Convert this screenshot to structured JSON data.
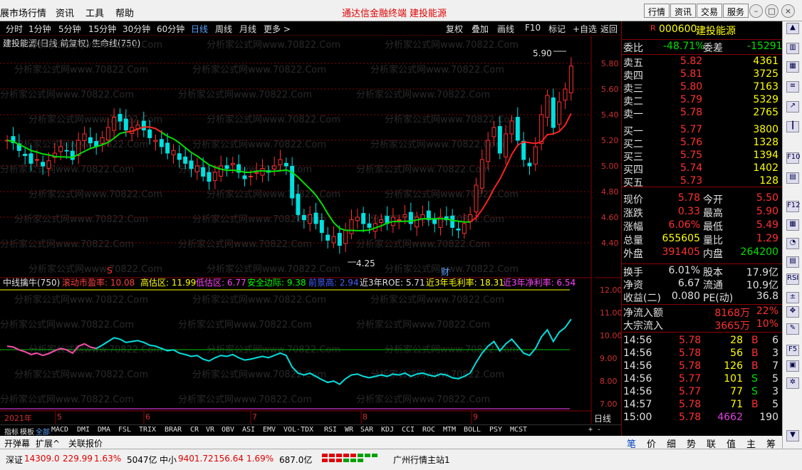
{
  "menu": {
    "items": [
      "展市场行情",
      "资讯",
      "工具",
      "帮助"
    ],
    "center_links": [
      "通达信金融终端",
      "建投能源"
    ],
    "right_buttons": [
      "行情",
      "资讯",
      "交易",
      "服务"
    ]
  },
  "toolbar": {
    "periods": [
      "分时",
      "1分钟",
      "5分钟",
      "15分钟",
      "30分钟",
      "60分钟",
      "日线",
      "周线",
      "月线",
      "更多 >"
    ],
    "active": "日线",
    "right_buttons": [
      "复权",
      "叠加",
      "画线",
      "F10",
      "标记",
      "+自选",
      "返回"
    ]
  },
  "chart": {
    "title": "建投能源(日线 前复权) 生命线(750)",
    "price_labels": [
      "5.80",
      "5.60",
      "5.40",
      "5.20",
      "5.00",
      "4.80",
      "4.60",
      "4.40"
    ],
    "high_marker": "5.90",
    "low_marker": "4.25",
    "signal_s": "S",
    "signal_cai": "财",
    "watermark": "分析家公式网www.70822.Com",
    "indicator_prices": [
      "12.00",
      "11.00",
      "10.00",
      "9.00",
      "8.00",
      "7.00"
    ],
    "date_labels": [
      "2021年",
      "5",
      "6",
      "7",
      "8",
      "9"
    ],
    "period_label": "日线"
  },
  "indicator": {
    "name": "中线擒牛(750)",
    "items": [
      {
        "label": "滚动市盈率: 10.08",
        "color": "#ff4040"
      },
      {
        "label": "高估区: 11.99",
        "color": "#ffff00"
      },
      {
        "label": "低估区: 6.77",
        "color": "#ff40ff"
      },
      {
        "label": "安全边际: 9.38",
        "color": "#00ff00"
      },
      {
        "label": "前景高: 2.94",
        "color": "#4060ff"
      },
      {
        "label": "近3年ROE: 5.71",
        "color": "#e0e0e0"
      },
      {
        "label": "近3年毛利率: 18.31",
        "color": "#ffff00"
      },
      {
        "label": "近3年净利率: 6.54",
        "color": "#ff40ff"
      }
    ]
  },
  "tabs": [
    "指标",
    "模板",
    "全部",
    "MACD",
    "DMI",
    "DMA",
    "FSL",
    "TRIX",
    "BRAR",
    "CR",
    "VR",
    "OBV",
    "ASI",
    "EMV",
    "VOL-TDX",
    "RSI",
    "WR",
    "SAR",
    "KDJ",
    "CCI",
    "ROC",
    "MTM",
    "BOLL",
    "PSY",
    "MCST"
  ],
  "tabs2": [
    "开弹幕",
    "扩展^",
    "关联报价"
  ],
  "status": {
    "sz": "深证",
    "sz_val": "14309.0",
    "sz_chg": "229.99",
    "sz_pct": "1.63%",
    "sz_amt": "5047亿",
    "zx": "中小",
    "zx_val": "9401.72",
    "zx_chg": "156.64",
    "zx_pct": "1.69%",
    "zx_amt": "687.0亿",
    "server": "广州行情主站1"
  },
  "quote": {
    "code": "000600",
    "name": "建投能源",
    "weibi_label": "委比",
    "weibi": "-48.71%",
    "weicha_label": "委差",
    "weicha": "-15291",
    "sells": [
      {
        "label": "卖五",
        "price": "5.82",
        "vol": "4361"
      },
      {
        "label": "卖四",
        "price": "5.81",
        "vol": "3725"
      },
      {
        "label": "卖三",
        "price": "5.80",
        "vol": "7163"
      },
      {
        "label": "卖二",
        "price": "5.79",
        "vol": "5329"
      },
      {
        "label": "卖一",
        "price": "5.78",
        "vol": "2765"
      }
    ],
    "buys": [
      {
        "label": "买一",
        "price": "5.77",
        "vol": "3800"
      },
      {
        "label": "买二",
        "price": "5.76",
        "vol": "1328"
      },
      {
        "label": "买三",
        "price": "5.75",
        "vol": "1394"
      },
      {
        "label": "买四",
        "price": "5.74",
        "vol": "1402"
      },
      {
        "label": "买五",
        "price": "5.73",
        "vol": "128"
      }
    ],
    "stats": [
      {
        "l1": "现价",
        "v1": "5.78",
        "c1": "r",
        "l2": "今开",
        "v2": "5.50",
        "c2": "r"
      },
      {
        "l1": "涨跌",
        "v1": "0.33",
        "c1": "r",
        "l2": "最高",
        "v2": "5.90",
        "c2": "r"
      },
      {
        "l1": "涨幅",
        "v1": "6.06%",
        "c1": "r",
        "l2": "最低",
        "v2": "5.49",
        "c2": "r"
      },
      {
        "l1": "总量",
        "v1": "655605",
        "c1": "y",
        "l2": "量比",
        "v2": "1.29",
        "c2": "r"
      },
      {
        "l1": "外盘",
        "v1": "391405",
        "c1": "r",
        "l2": "内盘",
        "v2": "264200",
        "c2": "g"
      }
    ],
    "stats2": [
      {
        "l1": "换手",
        "v1": "6.01%",
        "l2": "股本",
        "v2": "17.9亿"
      },
      {
        "l1": "净资",
        "v1": "6.67",
        "l2": "流通",
        "v2": "10.9亿"
      },
      {
        "l1": "收益(二)",
        "v1": "0.080",
        "l2": "PE(动)",
        "v2": "36.8"
      }
    ],
    "flow": [
      {
        "label": "净流入额",
        "val": "8168万",
        "pct": "22%"
      },
      {
        "label": "大宗流入",
        "val": "3665万",
        "pct": "10%"
      }
    ],
    "ticks": [
      {
        "time": "14:56",
        "price": "5.78",
        "vol": "28",
        "bs": "B",
        "n": "6"
      },
      {
        "time": "14:56",
        "price": "5.78",
        "vol": "56",
        "bs": "B",
        "n": "3"
      },
      {
        "time": "14:56",
        "price": "5.78",
        "vol": "126",
        "bs": "B",
        "n": "7"
      },
      {
        "time": "14:56",
        "price": "5.77",
        "vol": "101",
        "bs": "S",
        "n": "5"
      },
      {
        "time": "14:56",
        "price": "5.77",
        "vol": "77",
        "bs": "S",
        "n": "3"
      },
      {
        "time": "14:57",
        "price": "5.78",
        "vol": "71",
        "bs": "B",
        "n": "5"
      },
      {
        "time": "15:00",
        "price": "5.78",
        "vol": "4662",
        "bs": "",
        "n": "190"
      }
    ],
    "tabs": [
      "笔",
      "价",
      "细",
      "势",
      "联",
      "值",
      "主",
      "筹"
    ]
  },
  "sidebar_icons": [
    "up-arrow-icon",
    "chart-icon",
    "table-icon",
    "kline-icon",
    "f10-icon",
    "rsi-icon",
    "move-icon",
    "f5-icon",
    "down-arrow-icon"
  ]
}
